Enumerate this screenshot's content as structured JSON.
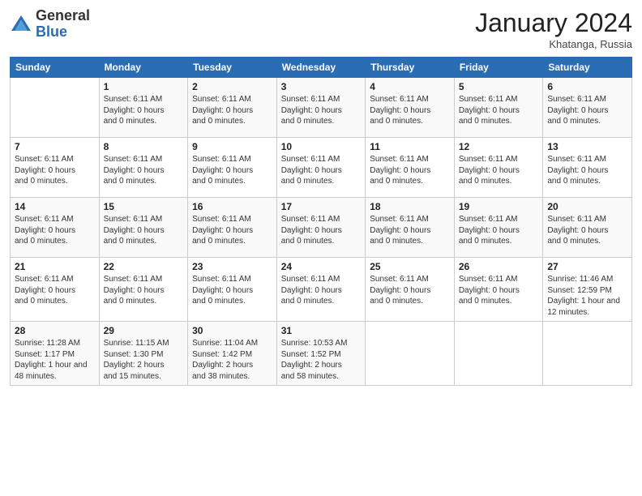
{
  "header": {
    "logo_general": "General",
    "logo_blue": "Blue",
    "month": "January 2024",
    "location": "Khatanga, Russia"
  },
  "weekdays": [
    "Sunday",
    "Monday",
    "Tuesday",
    "Wednesday",
    "Thursday",
    "Friday",
    "Saturday"
  ],
  "weeks": [
    [
      {
        "day": "",
        "info": ""
      },
      {
        "day": "1",
        "info": "Sunset: 6:11 AM\nDaylight: 0 hours\nand 0 minutes."
      },
      {
        "day": "2",
        "info": "Sunset: 6:11 AM\nDaylight: 0 hours\nand 0 minutes."
      },
      {
        "day": "3",
        "info": "Sunset: 6:11 AM\nDaylight: 0 hours\nand 0 minutes."
      },
      {
        "day": "4",
        "info": "Sunset: 6:11 AM\nDaylight: 0 hours\nand 0 minutes."
      },
      {
        "day": "5",
        "info": "Sunset: 6:11 AM\nDaylight: 0 hours\nand 0 minutes."
      },
      {
        "day": "6",
        "info": "Sunset: 6:11 AM\nDaylight: 0 hours\nand 0 minutes."
      }
    ],
    [
      {
        "day": "7",
        "info": "Sunset: 6:11 AM\nDaylight: 0 hours\nand 0 minutes."
      },
      {
        "day": "8",
        "info": "Sunset: 6:11 AM\nDaylight: 0 hours\nand 0 minutes."
      },
      {
        "day": "9",
        "info": "Sunset: 6:11 AM\nDaylight: 0 hours\nand 0 minutes."
      },
      {
        "day": "10",
        "info": "Sunset: 6:11 AM\nDaylight: 0 hours\nand 0 minutes."
      },
      {
        "day": "11",
        "info": "Sunset: 6:11 AM\nDaylight: 0 hours\nand 0 minutes."
      },
      {
        "day": "12",
        "info": "Sunset: 6:11 AM\nDaylight: 0 hours\nand 0 minutes."
      },
      {
        "day": "13",
        "info": "Sunset: 6:11 AM\nDaylight: 0 hours\nand 0 minutes."
      }
    ],
    [
      {
        "day": "14",
        "info": "Sunset: 6:11 AM\nDaylight: 0 hours\nand 0 minutes."
      },
      {
        "day": "15",
        "info": "Sunset: 6:11 AM\nDaylight: 0 hours\nand 0 minutes."
      },
      {
        "day": "16",
        "info": "Sunset: 6:11 AM\nDaylight: 0 hours\nand 0 minutes."
      },
      {
        "day": "17",
        "info": "Sunset: 6:11 AM\nDaylight: 0 hours\nand 0 minutes."
      },
      {
        "day": "18",
        "info": "Sunset: 6:11 AM\nDaylight: 0 hours\nand 0 minutes."
      },
      {
        "day": "19",
        "info": "Sunset: 6:11 AM\nDaylight: 0 hours\nand 0 minutes."
      },
      {
        "day": "20",
        "info": "Sunset: 6:11 AM\nDaylight: 0 hours\nand 0 minutes."
      }
    ],
    [
      {
        "day": "21",
        "info": "Sunset: 6:11 AM\nDaylight: 0 hours\nand 0 minutes."
      },
      {
        "day": "22",
        "info": "Sunset: 6:11 AM\nDaylight: 0 hours\nand 0 minutes."
      },
      {
        "day": "23",
        "info": "Sunset: 6:11 AM\nDaylight: 0 hours\nand 0 minutes."
      },
      {
        "day": "24",
        "info": "Sunset: 6:11 AM\nDaylight: 0 hours\nand 0 minutes."
      },
      {
        "day": "25",
        "info": "Sunset: 6:11 AM\nDaylight: 0 hours\nand 0 minutes."
      },
      {
        "day": "26",
        "info": "Sunset: 6:11 AM\nDaylight: 0 hours\nand 0 minutes."
      },
      {
        "day": "27",
        "info": "Sunrise: 11:46 AM\nSunset: 12:59 PM\nDaylight: 1 hour and\n12 minutes."
      }
    ],
    [
      {
        "day": "28",
        "info": "Sunrise: 11:28 AM\nSunset: 1:17 PM\nDaylight: 1 hour and\n48 minutes."
      },
      {
        "day": "29",
        "info": "Sunrise: 11:15 AM\nSunset: 1:30 PM\nDaylight: 2 hours\nand 15 minutes."
      },
      {
        "day": "30",
        "info": "Sunrise: 11:04 AM\nSunset: 1:42 PM\nDaylight: 2 hours\nand 38 minutes."
      },
      {
        "day": "31",
        "info": "Sunrise: 10:53 AM\nSunset: 1:52 PM\nDaylight: 2 hours\nand 58 minutes."
      },
      {
        "day": "",
        "info": ""
      },
      {
        "day": "",
        "info": ""
      },
      {
        "day": "",
        "info": ""
      }
    ]
  ]
}
